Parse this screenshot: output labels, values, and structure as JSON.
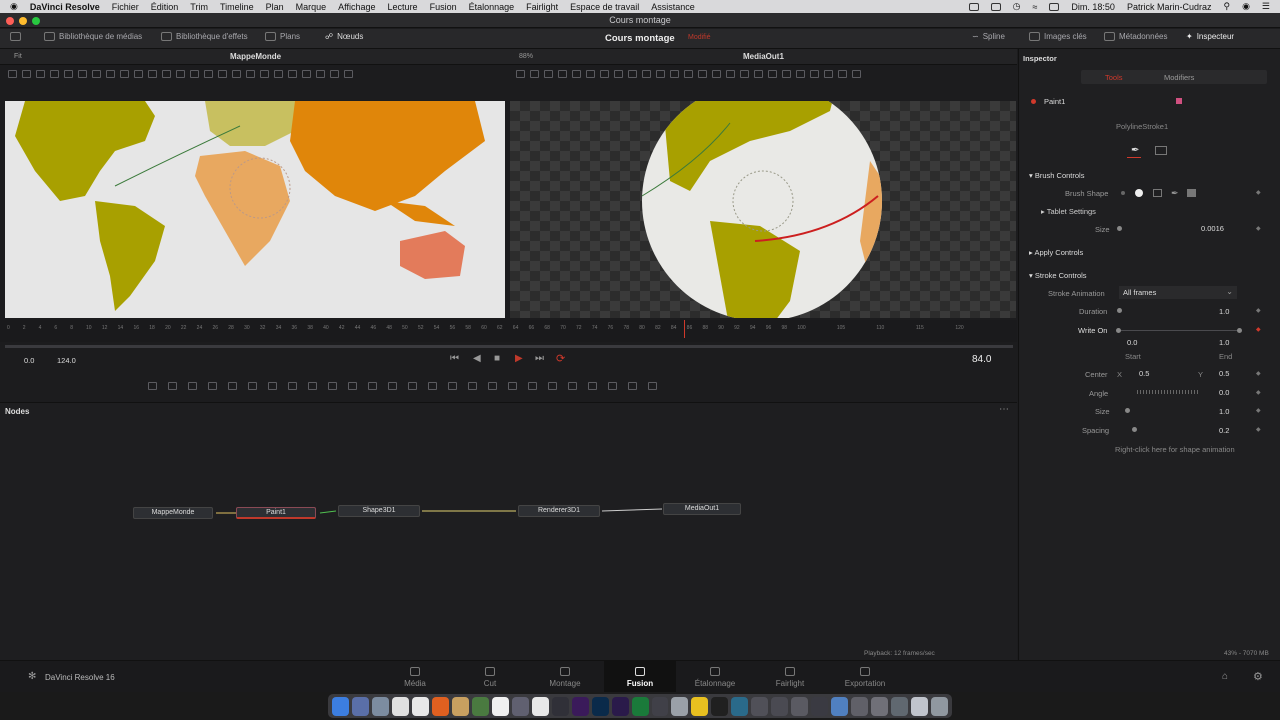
{
  "menubar": {
    "apple": "",
    "app": "DaVinci Resolve",
    "items": [
      "Fichier",
      "Édition",
      "Trim",
      "Timeline",
      "Plan",
      "Marque",
      "Affichage",
      "Lecture",
      "Fusion",
      "Étalonnage",
      "Fairlight",
      "Espace de travail",
      "Assistance"
    ],
    "clock": "Dim. 18:50",
    "user": "Patrick Marin-Cudraz"
  },
  "window": {
    "title": "Cours montage"
  },
  "toolbar": {
    "media_library": "Bibliothèque de médias",
    "effects_library": "Bibliothèque d'effets",
    "clips": "Plans",
    "nodes": "Nœuds",
    "project": "Cours montage",
    "modified": "Modifié",
    "spline": "Spline",
    "keyframes": "Images clés",
    "metadata": "Métadonnées",
    "inspector": "Inspecteur"
  },
  "viewers": {
    "left": {
      "fit": "Fit",
      "title": "MappeMonde"
    },
    "right": {
      "zoom": "88%",
      "title": "MediaOut1"
    }
  },
  "timeline": {
    "ticks": [
      "0",
      "2",
      "4",
      "6",
      "8",
      "10",
      "12",
      "14",
      "16",
      "18",
      "20",
      "22",
      "24",
      "26",
      "28",
      "30",
      "32",
      "34",
      "36",
      "38",
      "40",
      "42",
      "44",
      "46",
      "48",
      "50",
      "52",
      "54",
      "56",
      "58",
      "60",
      "62",
      "64",
      "66",
      "68",
      "70",
      "72",
      "74",
      "76",
      "78",
      "80",
      "82",
      "84",
      "86",
      "88",
      "90",
      "92",
      "94",
      "96",
      "98",
      "100",
      "105",
      "110",
      "115",
      "120"
    ],
    "start": "0.0",
    "end": "124.0",
    "current": "84.0"
  },
  "nodes_panel": {
    "title": "Nodes",
    "nodes": [
      "MappeMonde",
      "Paint1",
      "Shape3D1",
      "Renderer3D1",
      "MediaOut1"
    ],
    "playback": "Playback: 12 frames/sec",
    "memory": "43% - 7070 MB"
  },
  "inspector": {
    "title": "Inspector",
    "tab_tools": "Tools",
    "tab_modifiers": "Modifiers",
    "tool_name": "Paint1",
    "stroke_name": "PolylineStroke1",
    "brush_controls": "Brush Controls",
    "brush_shape": "Brush Shape",
    "tablet_settings": "Tablet Settings",
    "size_label": "Size",
    "size_value": "0.0016",
    "apply_controls": "Apply Controls",
    "stroke_controls": "Stroke Controls",
    "stroke_animation": "Stroke Animation",
    "stroke_animation_value": "All frames",
    "duration_label": "Duration",
    "duration_value": "1.0",
    "write_on_label": "Write On",
    "write_on_start": "0.0",
    "write_on_end": "1.0",
    "start_label": "Start",
    "end_label": "End",
    "center_label": "Center",
    "x_label": "X",
    "center_x": "0.5",
    "y_label": "Y",
    "center_y": "0.5",
    "angle_label": "Angle",
    "angle_value": "0.0",
    "size2_label": "Size",
    "size2_value": "1.0",
    "spacing_label": "Spacing",
    "spacing_value": "0.2",
    "hint": "Right-click here for shape animation"
  },
  "pages": [
    "Média",
    "Cut",
    "Montage",
    "Fusion",
    "Étalonnage",
    "Fairlight",
    "Exportation"
  ],
  "active_page": "Fusion",
  "brand": "DaVinci Resolve 16",
  "colors": {
    "accent_red": "#d0392b",
    "active_page": "#ffffff",
    "stroke": "#cc1f1f"
  }
}
